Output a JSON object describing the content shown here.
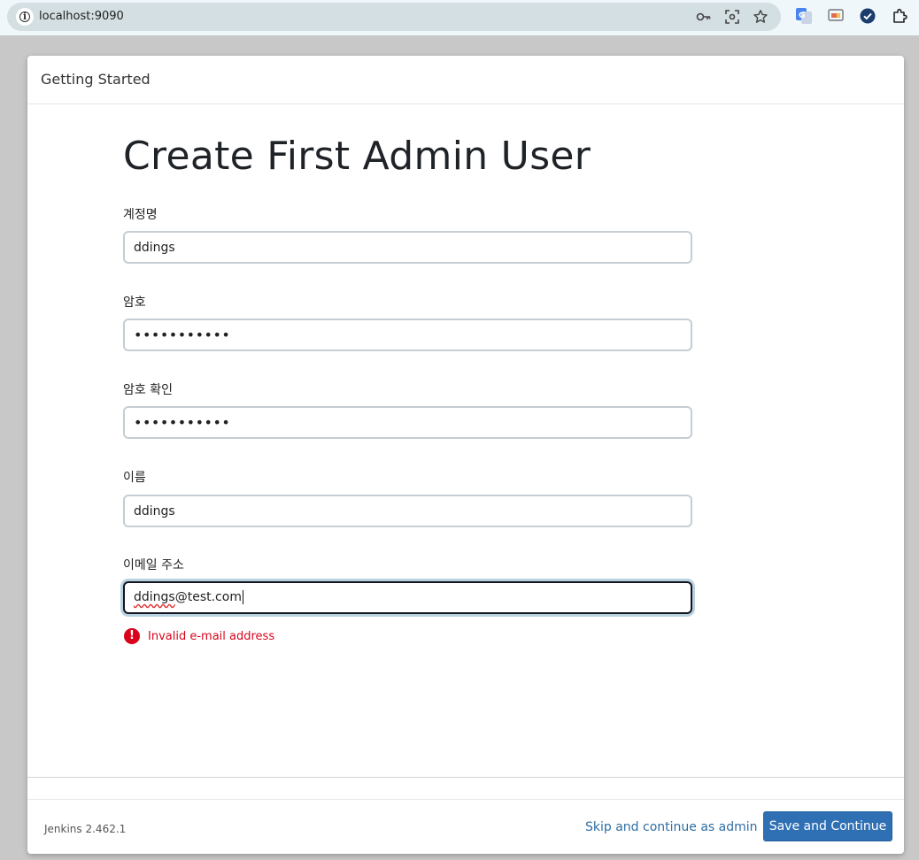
{
  "browser": {
    "url": "localhost:9090",
    "icons": [
      "info-icon",
      "key-icon",
      "screenshot-icon",
      "star-icon",
      "translate-icon",
      "cast-icon",
      "check-circle-icon",
      "puzzle-icon"
    ]
  },
  "panel": {
    "header_title": "Getting Started",
    "page_title": "Create First Admin User"
  },
  "form": {
    "username": {
      "label": "계정명",
      "value": "ddings"
    },
    "password": {
      "label": "암호",
      "value": "•••••••••••"
    },
    "password_confirm": {
      "label": "암호 확인",
      "value": "•••••••••••"
    },
    "fullname": {
      "label": "이름",
      "value": "ddings"
    },
    "email": {
      "label": "이메일 주소",
      "value_part1": "ddings",
      "value_part2": "@test.com"
    },
    "error": {
      "icon": "!",
      "text": "Invalid e-mail address",
      "color": "#d9041c"
    }
  },
  "footer": {
    "version": "Jenkins 2.462.1",
    "skip_label": "Skip and continue as admin",
    "save_label": "Save and Continue",
    "accent": "#2f70b5"
  }
}
